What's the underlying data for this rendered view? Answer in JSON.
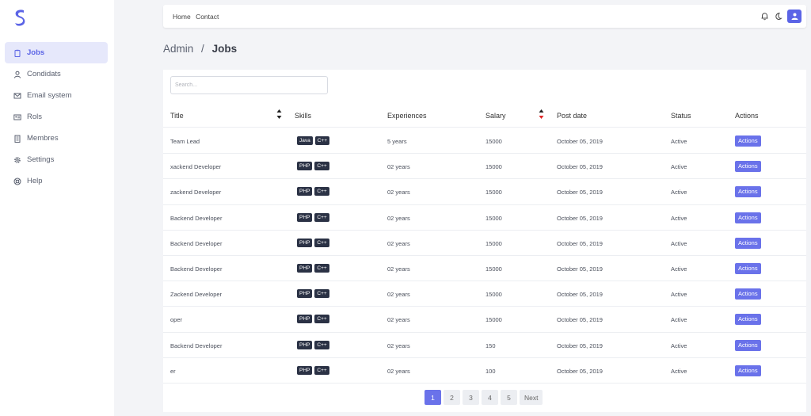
{
  "colors": {
    "accent": "#5b64e6",
    "button": "#6a72ea",
    "tag": "#2b3245",
    "sort_active": "#e02424"
  },
  "sidebar": {
    "items": [
      {
        "label": "Jobs",
        "icon": "clipboard-icon",
        "active": true
      },
      {
        "label": "Condidats",
        "icon": "user-icon",
        "active": false
      },
      {
        "label": "Email system",
        "icon": "mail-icon",
        "active": false
      },
      {
        "label": "Rols",
        "icon": "id-card-icon",
        "active": false
      },
      {
        "label": "Membres",
        "icon": "building-icon",
        "active": false
      },
      {
        "label": "Settings",
        "icon": "gear-icon",
        "active": false
      },
      {
        "label": "Help",
        "icon": "lifebuoy-icon",
        "active": false
      }
    ]
  },
  "topbar": {
    "home": "Home",
    "contact": "Contact"
  },
  "breadcrumb": {
    "root": "Admin",
    "sep": "/",
    "current": "Jobs"
  },
  "search": {
    "placeholder": "Search..."
  },
  "table": {
    "headers": {
      "title": "Title",
      "skills": "Skills",
      "experiences": "Experiences",
      "salary": "Salary",
      "post_date": "Post date",
      "status": "Status",
      "actions": "Actions"
    },
    "rows": [
      {
        "title": "Team Lead",
        "skills": [
          "Java",
          "C++"
        ],
        "experience": "5 years",
        "salary": "15000",
        "date": "October 05, 2019",
        "status": "Active",
        "action": "Actions"
      },
      {
        "title": "xackend Developer",
        "skills": [
          "PHP",
          "C++"
        ],
        "experience": "02 years",
        "salary": "15000",
        "date": "October 05, 2019",
        "status": "Active",
        "action": "Actions"
      },
      {
        "title": "zackend Developer",
        "skills": [
          "PHP",
          "C++"
        ],
        "experience": "02 years",
        "salary": "15000",
        "date": "October 05, 2019",
        "status": "Active",
        "action": "Actions"
      },
      {
        "title": "Backend Developer",
        "skills": [
          "PHP",
          "C++"
        ],
        "experience": "02 years",
        "salary": "15000",
        "date": "October 05, 2019",
        "status": "Active",
        "action": "Actions"
      },
      {
        "title": "Backend Developer",
        "skills": [
          "PHP",
          "C++"
        ],
        "experience": "02 years",
        "salary": "15000",
        "date": "October 05, 2019",
        "status": "Active",
        "action": "Actions"
      },
      {
        "title": "Backend Developer",
        "skills": [
          "PHP",
          "C++"
        ],
        "experience": "02 years",
        "salary": "15000",
        "date": "October 05, 2019",
        "status": "Active",
        "action": "Actions"
      },
      {
        "title": "Zackend Developer",
        "skills": [
          "PHP",
          "C++"
        ],
        "experience": "02 years",
        "salary": "15000",
        "date": "October 05, 2019",
        "status": "Active",
        "action": "Actions"
      },
      {
        "title": "oper",
        "skills": [
          "PHP",
          "C++"
        ],
        "experience": "02 years",
        "salary": "15000",
        "date": "October 05, 2019",
        "status": "Active",
        "action": "Actions"
      },
      {
        "title": "Backend Developer",
        "skills": [
          "PHP",
          "C++"
        ],
        "experience": "02 years",
        "salary": "150",
        "date": "October 05, 2019",
        "status": "Active",
        "action": "Actions"
      },
      {
        "title": "er",
        "skills": [
          "PHP",
          "C++"
        ],
        "experience": "02 years",
        "salary": "100",
        "date": "October 05, 2019",
        "status": "Active",
        "action": "Actions"
      }
    ]
  },
  "pagination": {
    "pages": [
      "1",
      "2",
      "3",
      "4",
      "5"
    ],
    "current": "1",
    "next": "Next"
  }
}
